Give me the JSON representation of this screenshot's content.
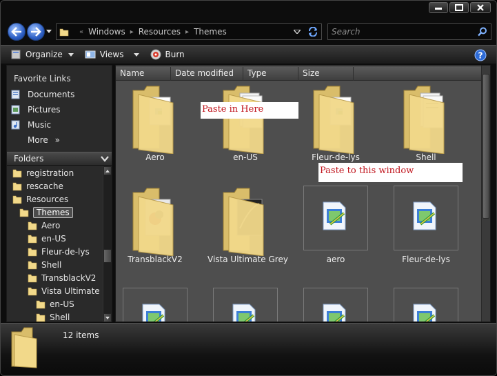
{
  "address": {
    "crumbs": [
      "Windows",
      "Resources",
      "Themes"
    ],
    "search_placeholder": "Search"
  },
  "toolbar": {
    "organize": "Organize",
    "views": "Views",
    "burn": "Burn"
  },
  "nav": {
    "favorite_links_title": "Favorite Links",
    "favorites": [
      "Documents",
      "Pictures",
      "Music"
    ],
    "more": "More",
    "folders_title": "Folders",
    "tree": [
      {
        "label": "registration",
        "level": 0
      },
      {
        "label": "rescache",
        "level": 0
      },
      {
        "label": "Resources",
        "level": 0
      },
      {
        "label": "Themes",
        "level": 1,
        "selected": true
      },
      {
        "label": "Aero",
        "level": 2
      },
      {
        "label": "en-US",
        "level": 2
      },
      {
        "label": "Fleur-de-lys",
        "level": 2
      },
      {
        "label": "Shell",
        "level": 2
      },
      {
        "label": "TransblackV2",
        "level": 2
      },
      {
        "label": "Vista Ultimate Grey",
        "level": 2
      },
      {
        "label": "en-US",
        "level": 3
      },
      {
        "label": "Shell",
        "level": 3
      }
    ]
  },
  "columns": [
    "Name",
    "Date modified",
    "Type",
    "Size"
  ],
  "items": [
    {
      "label": "Aero",
      "kind": "folder-doc"
    },
    {
      "label": "en-US",
      "kind": "folder-pages"
    },
    {
      "label": "Fleur-de-lys",
      "kind": "folder-doc"
    },
    {
      "label": "Shell",
      "kind": "folder-pages"
    },
    {
      "label": "TransblackV2",
      "kind": "folder-photo"
    },
    {
      "label": "Vista Ultimate Grey",
      "kind": "folder-dark"
    },
    {
      "label": "aero",
      "kind": "theme-file"
    },
    {
      "label": "Fleur-de-lys",
      "kind": "theme-file"
    },
    {
      "label": "",
      "kind": "theme-file"
    },
    {
      "label": "",
      "kind": "theme-file"
    },
    {
      "label": "",
      "kind": "theme-file"
    },
    {
      "label": "",
      "kind": "theme-file"
    }
  ],
  "annotations": {
    "paste_here": "Paste in Here",
    "paste_window": "Paste to this window"
  },
  "details": {
    "count": "12 items"
  },
  "colors": {
    "nav_blue": "#2d5fc4",
    "note_text": "#c0141c",
    "folder_yellow": "#f2d98a"
  }
}
